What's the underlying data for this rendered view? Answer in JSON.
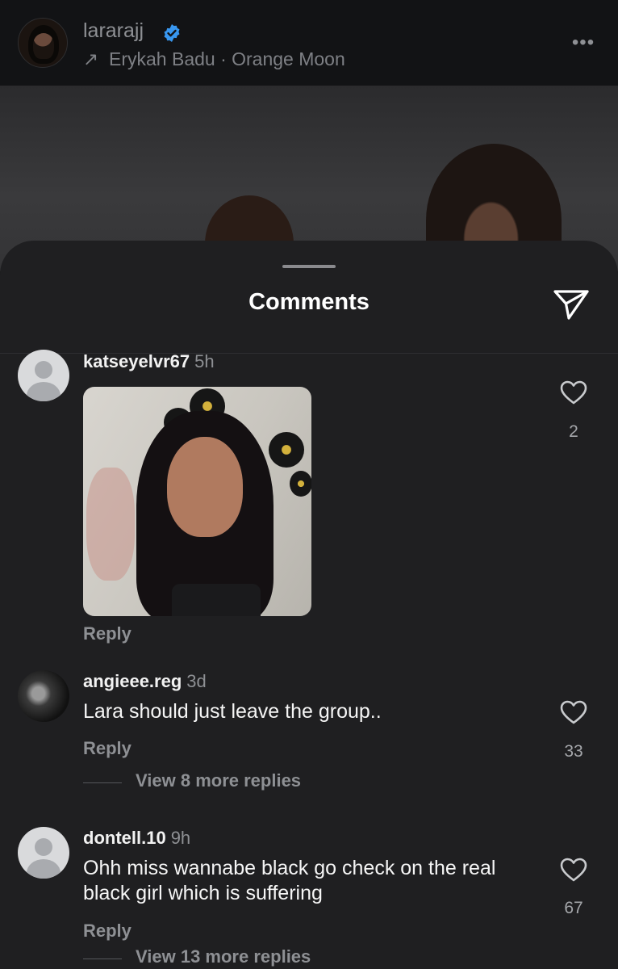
{
  "header": {
    "username": "lararajj",
    "verified": true,
    "music_arrow": "↗",
    "music": "Erykah Badu · Orange Moon",
    "more_icon": "•••"
  },
  "sheet": {
    "title": "Comments",
    "share_icon": "paper-plane-icon"
  },
  "comments": [
    {
      "username": "katseyelvr67",
      "time": "5h",
      "text": "",
      "has_media": true,
      "reply_label": "Reply",
      "likes": "2"
    },
    {
      "username": "angieee.reg",
      "time": "3d",
      "text": "Lara should just leave the group..",
      "reply_label": "Reply",
      "likes": "33",
      "view_replies": "View 8 more replies"
    },
    {
      "username": "dontell.10",
      "time": "9h",
      "text": "Ohh miss wannabe black go check on the real black girl which is suffering",
      "reply_label": "Reply",
      "likes": "67",
      "view_replies": "View 13 more replies"
    }
  ],
  "colors": {
    "background": "#121315",
    "sheet": "#1f1f21",
    "secondary_text": "#8e9094",
    "verified_blue": "#3897f0"
  }
}
